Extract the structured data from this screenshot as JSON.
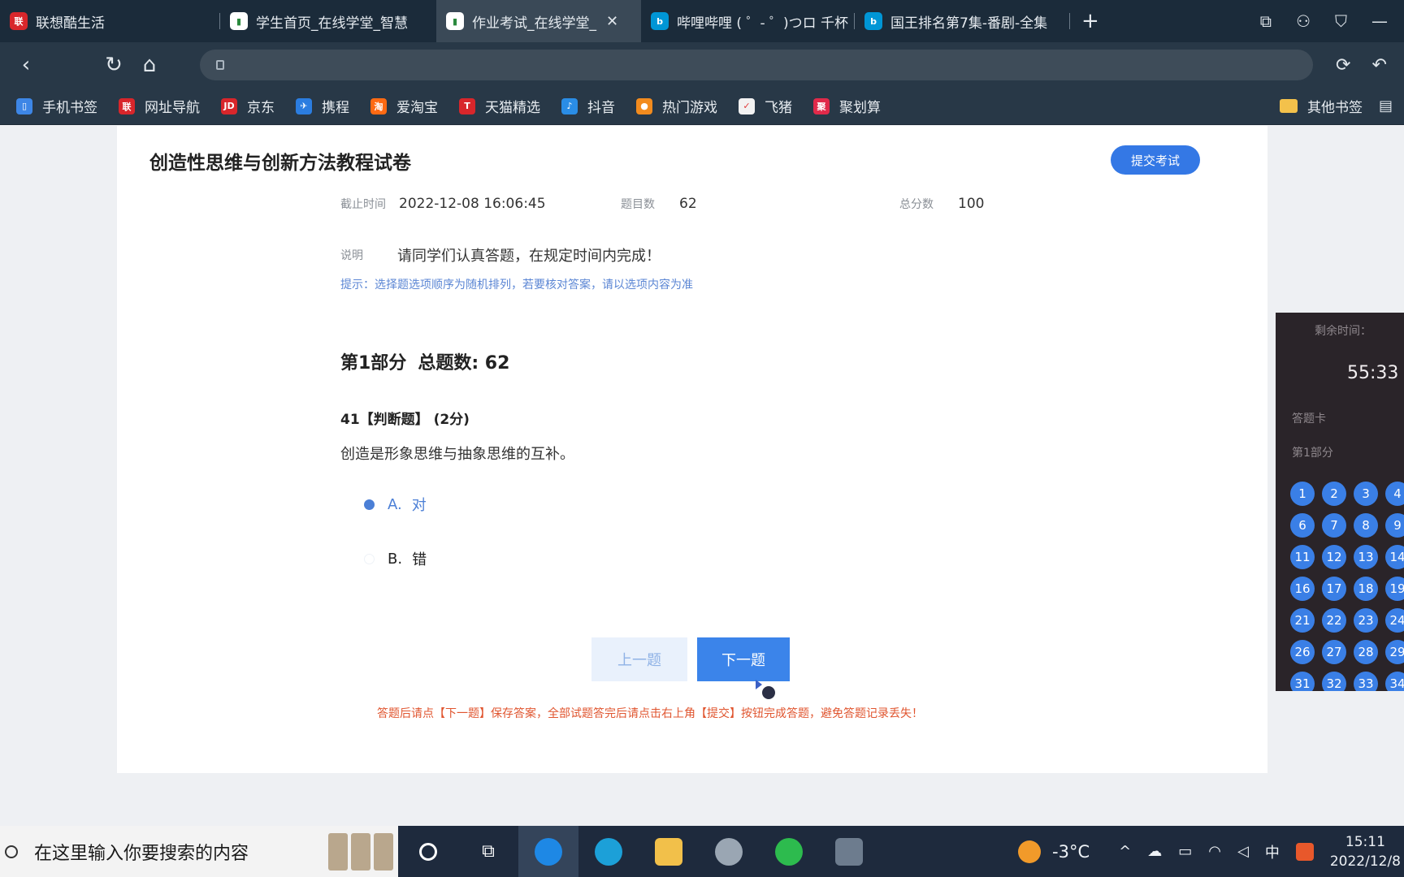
{
  "tabs": [
    {
      "label": "联想酷生活",
      "icon_color": "#d8262b",
      "active": false
    },
    {
      "label": "学生首页_在线学堂_智慧",
      "icon_color": "#ffffff",
      "active": false
    },
    {
      "label": "作业考试_在线学堂_",
      "icon_color": "#ffffff",
      "active": true
    },
    {
      "label": "哔哩哔哩 ( ゜- ゜)つロ 千杯",
      "icon_color": "#0096d6",
      "active": false
    },
    {
      "label": "国王排名第7集-番剧-全集",
      "icon_color": "#0096d6",
      "active": false
    }
  ],
  "bookmarks": [
    {
      "label": "手机书签",
      "icon_color": "#3d86e6"
    },
    {
      "label": "网址导航",
      "icon_color": "#d8262b"
    },
    {
      "label": "京东",
      "icon_color": "#d8262b",
      "icon_text": "JD"
    },
    {
      "label": "携程",
      "icon_color": "#2b7de0"
    },
    {
      "label": "爱淘宝",
      "icon_color": "#ff6a13",
      "icon_text": "淘"
    },
    {
      "label": "天猫精选",
      "icon_color": "#d8262b",
      "icon_text": "T"
    },
    {
      "label": "抖音",
      "icon_color": "#2a8de6"
    },
    {
      "label": "热门游戏",
      "icon_color": "#f28b1e"
    },
    {
      "label": "飞猪",
      "icon_color": "#f2f2f2"
    },
    {
      "label": "聚划算",
      "icon_color": "#e02a4a",
      "icon_text": "聚"
    }
  ],
  "bookmarks_other": "其他书签",
  "exam": {
    "title": "创造性思维与创新方法教程试卷",
    "submit_label": "提交考试",
    "deadline_label": "截止时间",
    "deadline": "2022-12-08 16:06:45",
    "count_label": "题目数",
    "count": "62",
    "score_label": "总分数",
    "score": "100",
    "desc_label": "说明",
    "desc": "请同学们认真答题，在规定时间内完成！",
    "hint": "提示：选择题选项顺序为随机排列，若要核对答案，请以选项内容为准",
    "part_name": "第1部分",
    "part_total": "总题数: 62",
    "question_head": "41【判断题】 (2分)",
    "question_text": "创造是形象思维与抽象思维的互补。",
    "options": [
      {
        "key": "A.",
        "text": "对",
        "selected": true
      },
      {
        "key": "B.",
        "text": "错",
        "selected": false
      }
    ],
    "prev_label": "上一题",
    "next_label": "下一题",
    "warning": "答题后请点【下一题】保存答案，全部试题答完后请点击右上角【提交】按钮完成答题，避免答题记录丢失！"
  },
  "side_panel": {
    "remaining_label": "剩余时间：",
    "timer": "55:33",
    "answered_label": "答题卡",
    "part_label": "第1部分",
    "numbers": [
      "1",
      "2",
      "3",
      "4",
      "6",
      "7",
      "8",
      "9",
      "11",
      "12",
      "13",
      "14",
      "16",
      "17",
      "18",
      "19",
      "21",
      "22",
      "23",
      "24",
      "26",
      "27",
      "28",
      "29",
      "31",
      "32",
      "33",
      "34"
    ]
  },
  "taskbar": {
    "search_placeholder": "在这里输入你要搜索的内容",
    "temperature": "-3°C",
    "ime": "中",
    "time": "15:11",
    "date": "2022/12/8"
  }
}
